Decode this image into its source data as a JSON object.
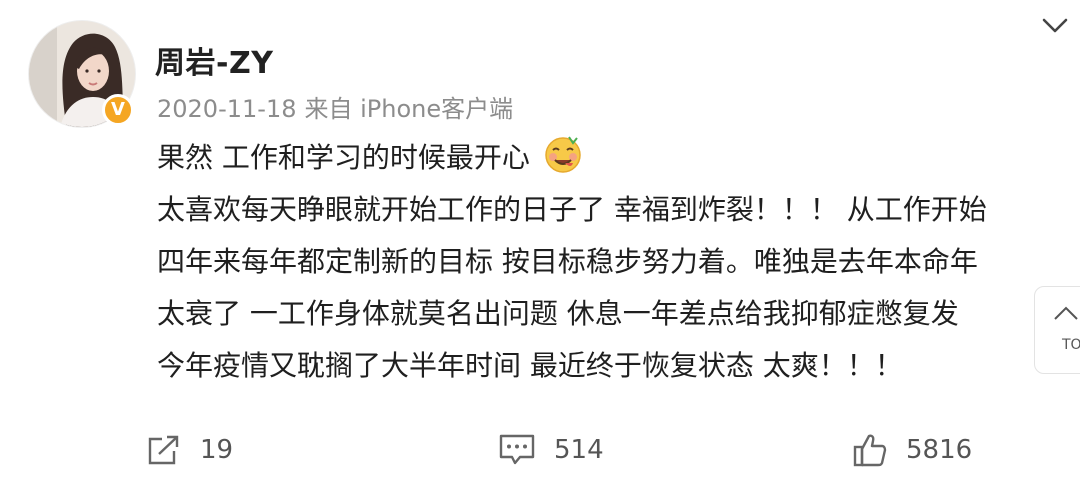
{
  "post": {
    "username": "周岩-ZY",
    "verified_badge": "V",
    "date": "2020-11-18",
    "source": "来自 iPhone客户端",
    "content_lines": [
      "果然 工作和学习的时候最开心",
      "太喜欢每天睁眼就开始工作的日子了 幸福到炸裂！！！ 从工作开始",
      "四年来每年都定制新的目标 按目标稳步努力着。唯独是去年本命年",
      "太衰了 一工作身体就莫名出问题 休息一年差点给我抑郁症憋复发",
      "今年疫情又耽搁了大半年时间 最近终于恢复状态 太爽！！！"
    ],
    "emoji": "savoring-food-emoji"
  },
  "actions": {
    "reposts": "19",
    "comments": "514",
    "likes": "5816"
  },
  "scroll_to_top": {
    "label": "TO"
  },
  "colors": {
    "badge": "#f5a623",
    "meta_text": "#8c8c8c",
    "icon": "#666666"
  }
}
